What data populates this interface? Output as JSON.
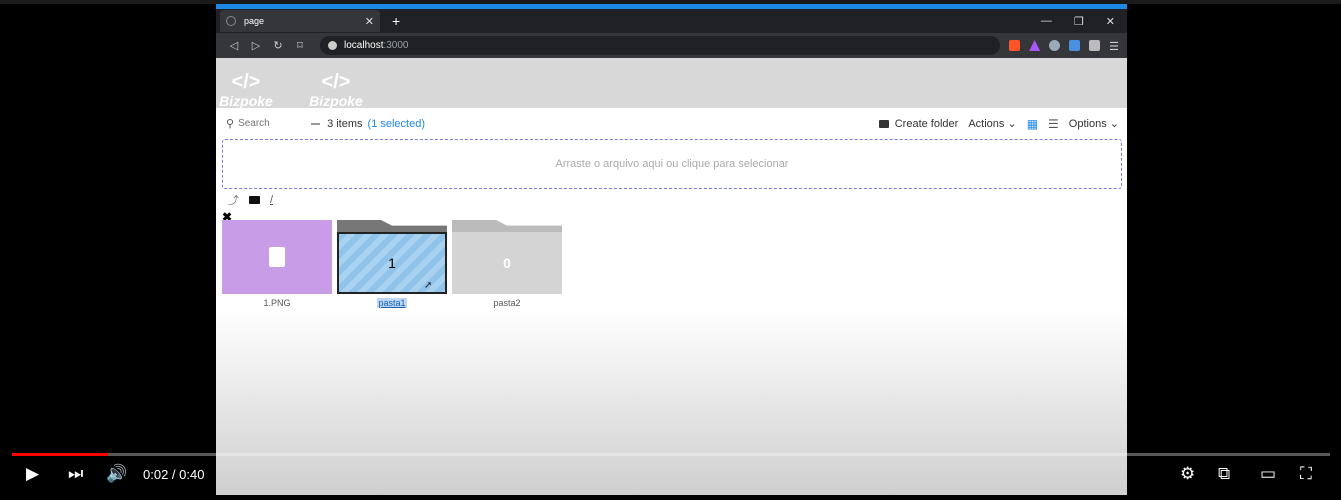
{
  "browser": {
    "tab_title": "page",
    "url_host": "localhost",
    "url_port": ":3000"
  },
  "header": {
    "logos": [
      "Bizpoke",
      "Bizpoke"
    ]
  },
  "toolbar": {
    "search_placeholder": "Search",
    "item_count": "3 items",
    "selected_count": "(1 selected)",
    "create_folder": "Create folder",
    "actions": "Actions",
    "options": "Options"
  },
  "dropzone": {
    "text": "Arraste o arquivo aqui ou clique para selecionar"
  },
  "breadcrumb": {
    "root": "/"
  },
  "items": [
    {
      "name": "1.PNG",
      "kind": "file"
    },
    {
      "name": "pasta1",
      "kind": "folder",
      "count": "1",
      "selected": true
    },
    {
      "name": "pasta2",
      "kind": "folder",
      "count": "0"
    }
  ],
  "player": {
    "time": "0:02 / 0:40",
    "progress": 0.073
  },
  "colors": {
    "accent": "#1e88e5",
    "file_thumb": "#c89ce6",
    "progress": "#ff0000"
  }
}
